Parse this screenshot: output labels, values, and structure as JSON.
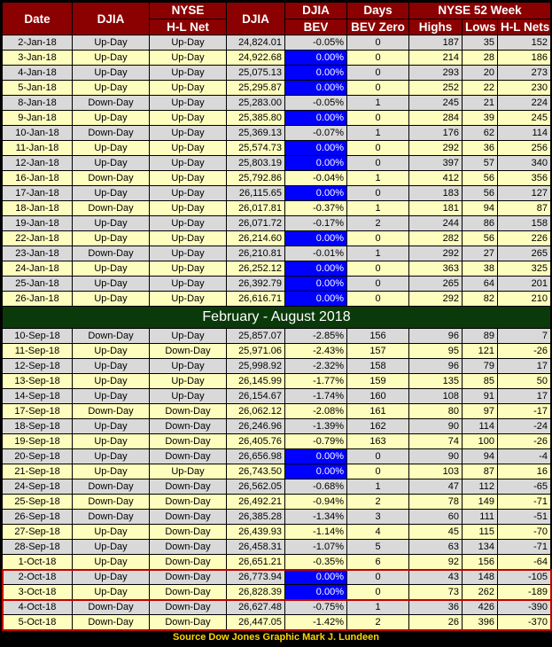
{
  "headers": {
    "date": "Date",
    "djia1": "DJIA",
    "nyse_hl_top": "NYSE",
    "nyse_hl_bottom": "H-L Net",
    "djia2": "DJIA",
    "bev_top": "DJIA",
    "bev_bottom": "BEV",
    "days_top": "Days",
    "days_bottom": "BEV Zero",
    "nyse52": "NYSE 52 Week",
    "highs": "Highs",
    "lows": "Lows",
    "nets": "H-L Nets"
  },
  "colors": {
    "header_bg": "#8b0000",
    "bev_zero": "#0000ff",
    "row_alt": "#fdfdbd",
    "row_grey": "#d9d9d9",
    "separator": "#0a3a0a",
    "highlight_box": "#c00000",
    "footer": "#ffd700"
  },
  "rows_a": [
    [
      "2-Jan-18",
      "Up-Day",
      "Up-Day",
      "24,824.01",
      "-0.05%",
      "0",
      "187",
      "35",
      "152"
    ],
    [
      "3-Jan-18",
      "Up-Day",
      "Up-Day",
      "24,922.68",
      "0.00%",
      "0",
      "214",
      "28",
      "186"
    ],
    [
      "4-Jan-18",
      "Up-Day",
      "Up-Day",
      "25,075.13",
      "0.00%",
      "0",
      "293",
      "20",
      "273"
    ],
    [
      "5-Jan-18",
      "Up-Day",
      "Up-Day",
      "25,295.87",
      "0.00%",
      "0",
      "252",
      "22",
      "230"
    ],
    [
      "8-Jan-18",
      "Down-Day",
      "Up-Day",
      "25,283.00",
      "-0.05%",
      "1",
      "245",
      "21",
      "224"
    ],
    [
      "9-Jan-18",
      "Up-Day",
      "Up-Day",
      "25,385.80",
      "0.00%",
      "0",
      "284",
      "39",
      "245"
    ],
    [
      "10-Jan-18",
      "Down-Day",
      "Up-Day",
      "25,369.13",
      "-0.07%",
      "1",
      "176",
      "62",
      "114"
    ],
    [
      "11-Jan-18",
      "Up-Day",
      "Up-Day",
      "25,574.73",
      "0.00%",
      "0",
      "292",
      "36",
      "256"
    ],
    [
      "12-Jan-18",
      "Up-Day",
      "Up-Day",
      "25,803.19",
      "0.00%",
      "0",
      "397",
      "57",
      "340"
    ],
    [
      "16-Jan-18",
      "Down-Day",
      "Up-Day",
      "25,792.86",
      "-0.04%",
      "1",
      "412",
      "56",
      "356"
    ],
    [
      "17-Jan-18",
      "Up-Day",
      "Up-Day",
      "26,115.65",
      "0.00%",
      "0",
      "183",
      "56",
      "127"
    ],
    [
      "18-Jan-18",
      "Down-Day",
      "Up-Day",
      "26,017.81",
      "-0.37%",
      "1",
      "181",
      "94",
      "87"
    ],
    [
      "19-Jan-18",
      "Up-Day",
      "Up-Day",
      "26,071.72",
      "-0.17%",
      "2",
      "244",
      "86",
      "158"
    ],
    [
      "22-Jan-18",
      "Up-Day",
      "Up-Day",
      "26,214.60",
      "0.00%",
      "0",
      "282",
      "56",
      "226"
    ],
    [
      "23-Jan-18",
      "Down-Day",
      "Up-Day",
      "26,210.81",
      "-0.01%",
      "1",
      "292",
      "27",
      "265"
    ],
    [
      "24-Jan-18",
      "Up-Day",
      "Up-Day",
      "26,252.12",
      "0.00%",
      "0",
      "363",
      "38",
      "325"
    ],
    [
      "25-Jan-18",
      "Up-Day",
      "Up-Day",
      "26,392.79",
      "0.00%",
      "0",
      "265",
      "64",
      "201"
    ],
    [
      "26-Jan-18",
      "Up-Day",
      "Up-Day",
      "26,616.71",
      "0.00%",
      "0",
      "292",
      "82",
      "210"
    ]
  ],
  "separator": "February - August 2018",
  "rows_b": [
    [
      "10-Sep-18",
      "Down-Day",
      "Up-Day",
      "25,857.07",
      "-2.85%",
      "156",
      "96",
      "89",
      "7"
    ],
    [
      "11-Sep-18",
      "Up-Day",
      "Down-Day",
      "25,971.06",
      "-2.43%",
      "157",
      "95",
      "121",
      "-26"
    ],
    [
      "12-Sep-18",
      "Up-Day",
      "Up-Day",
      "25,998.92",
      "-2.32%",
      "158",
      "96",
      "79",
      "17"
    ],
    [
      "13-Sep-18",
      "Up-Day",
      "Up-Day",
      "26,145.99",
      "-1.77%",
      "159",
      "135",
      "85",
      "50"
    ],
    [
      "14-Sep-18",
      "Up-Day",
      "Up-Day",
      "26,154.67",
      "-1.74%",
      "160",
      "108",
      "91",
      "17"
    ],
    [
      "17-Sep-18",
      "Down-Day",
      "Down-Day",
      "26,062.12",
      "-2.08%",
      "161",
      "80",
      "97",
      "-17"
    ],
    [
      "18-Sep-18",
      "Up-Day",
      "Down-Day",
      "26,246.96",
      "-1.39%",
      "162",
      "90",
      "114",
      "-24"
    ],
    [
      "19-Sep-18",
      "Up-Day",
      "Down-Day",
      "26,405.76",
      "-0.79%",
      "163",
      "74",
      "100",
      "-26"
    ],
    [
      "20-Sep-18",
      "Up-Day",
      "Down-Day",
      "26,656.98",
      "0.00%",
      "0",
      "90",
      "94",
      "-4"
    ],
    [
      "21-Sep-18",
      "Up-Day",
      "Up-Day",
      "26,743.50",
      "0.00%",
      "0",
      "103",
      "87",
      "16"
    ],
    [
      "24-Sep-18",
      "Down-Day",
      "Down-Day",
      "26,562.05",
      "-0.68%",
      "1",
      "47",
      "112",
      "-65"
    ],
    [
      "25-Sep-18",
      "Down-Day",
      "Down-Day",
      "26,492.21",
      "-0.94%",
      "2",
      "78",
      "149",
      "-71"
    ],
    [
      "26-Sep-18",
      "Down-Day",
      "Down-Day",
      "26,385.28",
      "-1.34%",
      "3",
      "60",
      "111",
      "-51"
    ],
    [
      "27-Sep-18",
      "Up-Day",
      "Down-Day",
      "26,439.93",
      "-1.14%",
      "4",
      "45",
      "115",
      "-70"
    ],
    [
      "28-Sep-18",
      "Up-Day",
      "Down-Day",
      "26,458.31",
      "-1.07%",
      "5",
      "63",
      "134",
      "-71"
    ],
    [
      "1-Oct-18",
      "Up-Day",
      "Down-Day",
      "26,651.21",
      "-0.35%",
      "6",
      "92",
      "156",
      "-64"
    ],
    [
      "2-Oct-18",
      "Up-Day",
      "Down-Day",
      "26,773.94",
      "0.00%",
      "0",
      "43",
      "148",
      "-105"
    ],
    [
      "3-Oct-18",
      "Up-Day",
      "Down-Day",
      "26,828.39",
      "0.00%",
      "0",
      "73",
      "262",
      "-189"
    ],
    [
      "4-Oct-18",
      "Down-Day",
      "Down-Day",
      "26,627.48",
      "-0.75%",
      "1",
      "36",
      "426",
      "-390"
    ],
    [
      "5-Oct-18",
      "Down-Day",
      "Down-Day",
      "26,447.05",
      "-1.42%",
      "2",
      "26",
      "396",
      "-370"
    ]
  ],
  "footer": "Source Dow Jones   Graphic Mark J. Lundeen"
}
